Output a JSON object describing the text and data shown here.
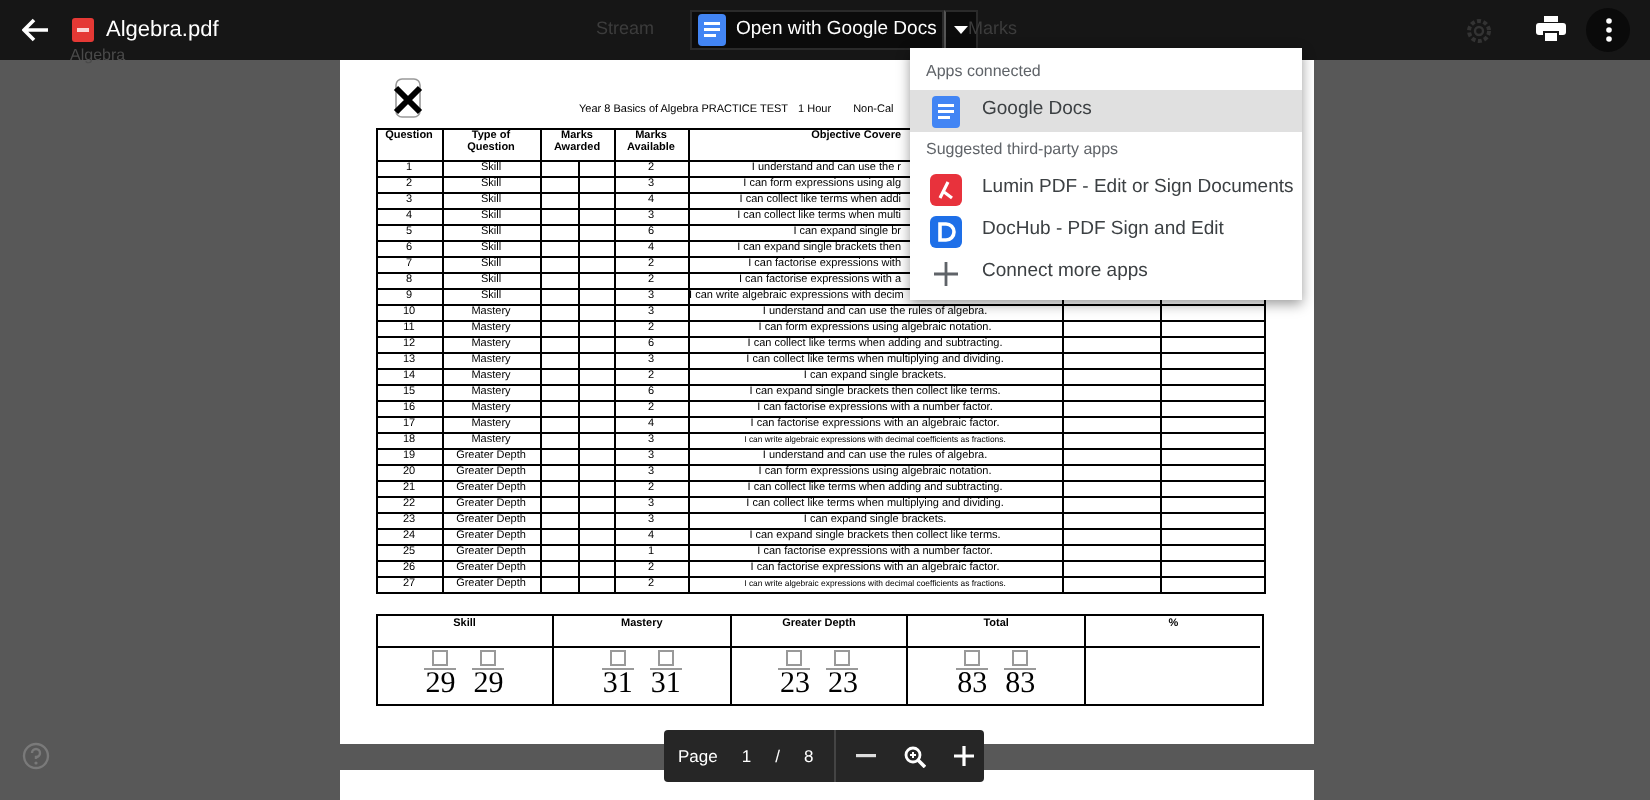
{
  "header": {
    "title": "Algebra.pdf",
    "subtitle": "Algebra",
    "open_button": "Open with Google Docs"
  },
  "background_tabs": [
    "Stream",
    "Marks"
  ],
  "dropdown": {
    "sections": [
      {
        "heading": "Apps connected",
        "items": [
          {
            "label": "Google Docs",
            "kind": "docs",
            "selected": true
          }
        ]
      },
      {
        "heading": "Suggested third-party apps",
        "items": [
          {
            "label": "Lumin PDF - Edit or Sign Documents",
            "kind": "lumin",
            "selected": false
          },
          {
            "label": "DocHub - PDF Sign and Edit",
            "kind": "dochub",
            "selected": false
          },
          {
            "label": "Connect more apps",
            "kind": "add",
            "selected": false
          }
        ]
      }
    ]
  },
  "document": {
    "title": [
      "Year 8 Basics of Algebra PRACTICE TEST",
      "1 Hour",
      "Non-Cal"
    ],
    "table": {
      "columns": [
        "Question",
        "Type of Question",
        "Marks Awarded",
        "Marks Available",
        "Objective Covere"
      ],
      "rows": [
        {
          "question": "1",
          "type": "Skill",
          "available": "2",
          "objective": "I understand and can use the r"
        },
        {
          "question": "2",
          "type": "Skill",
          "available": "3",
          "objective": "I can form expressions using alg"
        },
        {
          "question": "3",
          "type": "Skill",
          "available": "4",
          "objective": "I can collect like terms when addi"
        },
        {
          "question": "4",
          "type": "Skill",
          "available": "3",
          "objective": "I can collect like terms when multi"
        },
        {
          "question": "5",
          "type": "Skill",
          "available": "6",
          "objective": "I can expand single br"
        },
        {
          "question": "6",
          "type": "Skill",
          "available": "4",
          "objective": "I can expand single brackets then"
        },
        {
          "question": "7",
          "type": "Skill",
          "available": "2",
          "objective": "I can factorise expressions with"
        },
        {
          "question": "8",
          "type": "Skill",
          "available": "2",
          "objective": "I can factorise expressions with a"
        },
        {
          "question": "9",
          "type": "Skill",
          "available": "3",
          "objective": "I can write algebraic expressions with decim"
        },
        {
          "question": "10",
          "type": "Mastery",
          "available": "3",
          "objective": "I understand and can use the rules of algebra."
        },
        {
          "question": "11",
          "type": "Mastery",
          "available": "2",
          "objective": "I can form expressions using algebraic notation."
        },
        {
          "question": "12",
          "type": "Mastery",
          "available": "6",
          "objective": "I can collect like terms when adding and subtracting."
        },
        {
          "question": "13",
          "type": "Mastery",
          "available": "3",
          "objective": "I can collect like terms when multiplying and dividing."
        },
        {
          "question": "14",
          "type": "Mastery",
          "available": "2",
          "objective": "I can expand single brackets."
        },
        {
          "question": "15",
          "type": "Mastery",
          "available": "6",
          "objective": "I can expand single brackets then collect like terms."
        },
        {
          "question": "16",
          "type": "Mastery",
          "available": "2",
          "objective": "I can factorise expressions with a number factor."
        },
        {
          "question": "17",
          "type": "Mastery",
          "available": "4",
          "objective": "I can factorise expressions with an algebraic factor."
        },
        {
          "question": "18",
          "type": "Mastery",
          "available": "3",
          "objective": "I can write algebraic expressions with decimal coefficients as fractions."
        },
        {
          "question": "19",
          "type": "Greater Depth",
          "available": "3",
          "objective": "I understand and can use the rules of algebra."
        },
        {
          "question": "20",
          "type": "Greater Depth",
          "available": "3",
          "objective": "I can form expressions using algebraic notation."
        },
        {
          "question": "21",
          "type": "Greater Depth",
          "available": "2",
          "objective": "I can collect like terms when adding and subtracting."
        },
        {
          "question": "22",
          "type": "Greater Depth",
          "available": "3",
          "objective": "I can collect like terms when multiplying and dividing."
        },
        {
          "question": "23",
          "type": "Greater Depth",
          "available": "3",
          "objective": "I can expand single brackets."
        },
        {
          "question": "24",
          "type": "Greater Depth",
          "available": "4",
          "objective": "I can expand single brackets then collect like terms."
        },
        {
          "question": "25",
          "type": "Greater Depth",
          "available": "1",
          "objective": "I can factorise expressions with a number factor."
        },
        {
          "question": "26",
          "type": "Greater Depth",
          "available": "2",
          "objective": "I can factorise expressions with an algebraic factor."
        },
        {
          "question": "27",
          "type": "Greater Depth",
          "available": "2",
          "objective": "I can write algebraic expressions with decimal coefficients as fractions."
        }
      ]
    },
    "summary": [
      {
        "label": "Skill",
        "numbers": [
          "29",
          "29"
        ]
      },
      {
        "label": "Mastery",
        "numbers": [
          "31",
          "31"
        ]
      },
      {
        "label": "Greater Depth",
        "numbers": [
          "23",
          "23"
        ]
      },
      {
        "label": "Total",
        "numbers": [
          "83",
          "83"
        ]
      },
      {
        "label": "%"
      }
    ]
  },
  "pager": {
    "label": "Page",
    "current": "1",
    "separator": "/",
    "total": "8"
  }
}
